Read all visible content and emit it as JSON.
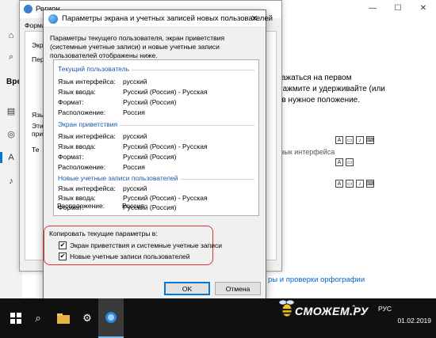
{
  "settings": {
    "bg_lines": [
      "ображаться на первом",
      "л. Нажмите и удерживайте (или",
      "его в нужное положение."
    ],
    "lang_row_text": "ь, Язык интерфейса",
    "heading_fragment": "ры",
    "link1": "ры",
    "link2": "ры и проверки орфографии",
    "sidebar_heading": "Вре"
  },
  "region_window": {
    "title": "Регион",
    "tab": "Форма",
    "panel_lines": [
      "Экр",
      "Пер",
      "Язы",
      "Эти",
      "при",
      "Те"
    ]
  },
  "dialog": {
    "title": "Параметры экрана и учетных записей новых пользователей",
    "description": "Параметры текущего пользователя, экран приветствия (системные учетные записи) и новые учетные записи пользователей отображены ниже.",
    "sections": [
      {
        "heading": "Текущий пользователь",
        "rows": [
          {
            "k": "Язык интерфейса:",
            "v": "русский"
          },
          {
            "k": "Язык ввода:",
            "v": "Русский (Россия) - Русская"
          },
          {
            "k": "Формат:",
            "v": "Русский (Россия)"
          },
          {
            "k": "Расположение:",
            "v": "Россия"
          }
        ]
      },
      {
        "heading": "Экран приветствия",
        "rows": [
          {
            "k": "Язык интерфейса:",
            "v": "русский"
          },
          {
            "k": "Язык ввода:",
            "v": "Русский (Россия) - Русская"
          },
          {
            "k": "Формат:",
            "v": "Русский (Россия)"
          },
          {
            "k": "Расположение:",
            "v": "Россия"
          }
        ]
      },
      {
        "heading": "Новые учетные записи пользователей",
        "rows": [
          {
            "k": "Язык интерфейса:",
            "v": "русский"
          },
          {
            "k": "Язык ввода:",
            "v": "Русский (Россия) - Русская"
          },
          {
            "k": "Формат:",
            "v": "Русский (Россия)"
          },
          {
            "k": "Расположение:",
            "v": "Россия"
          }
        ]
      }
    ],
    "copy_label": "Копировать текущие параметры в:",
    "checkbox1": {
      "label": "Экран приветствия и системные учетные записи",
      "checked": true
    },
    "checkbox2": {
      "label": "Новые учетные записи пользователей",
      "checked": true
    },
    "ok_label": "OK",
    "cancel_label": "Отмена"
  },
  "taskbar": {
    "lang": "РУС",
    "date": "01.02.2019"
  },
  "watermark": "СМОЖЕМ.РУ",
  "colors": {
    "highlight": "#e0303a",
    "accent": "#0078d7",
    "section_heading": "#1e5aa8"
  }
}
